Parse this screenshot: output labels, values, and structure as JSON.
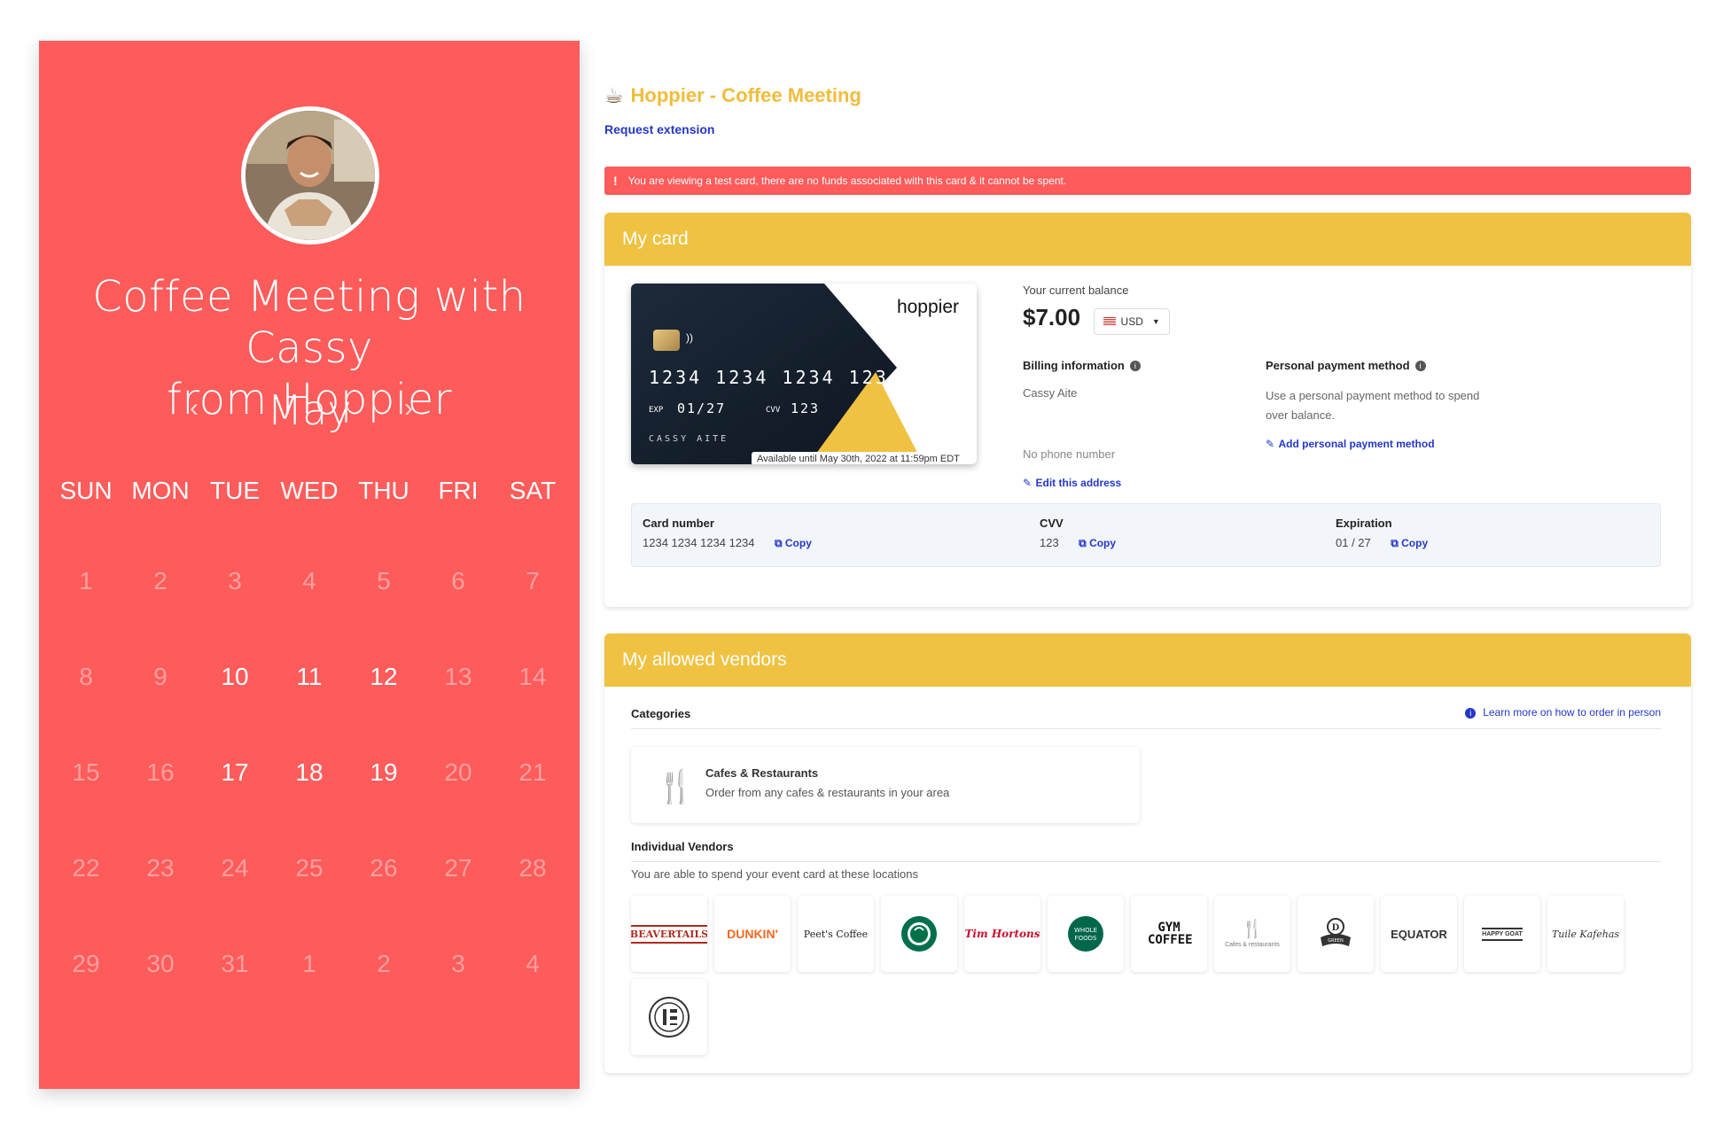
{
  "calendar": {
    "title": "Coffee Meeting with Cassy from Hoppier",
    "month": "May",
    "prev_icon": "chevron-left-icon",
    "next_icon": "chevron-right-icon",
    "weekdays": [
      "SUN",
      "MON",
      "TUE",
      "WED",
      "THU",
      "FRI",
      "SAT"
    ],
    "days": [
      {
        "n": "1",
        "active": false
      },
      {
        "n": "2",
        "active": false
      },
      {
        "n": "3",
        "active": false
      },
      {
        "n": "4",
        "active": false
      },
      {
        "n": "5",
        "active": false
      },
      {
        "n": "6",
        "active": false
      },
      {
        "n": "7",
        "active": false
      },
      {
        "n": "8",
        "active": false
      },
      {
        "n": "9",
        "active": false
      },
      {
        "n": "10",
        "active": true
      },
      {
        "n": "11",
        "active": true
      },
      {
        "n": "12",
        "active": true
      },
      {
        "n": "13",
        "active": false
      },
      {
        "n": "14",
        "active": false
      },
      {
        "n": "15",
        "active": false
      },
      {
        "n": "16",
        "active": false
      },
      {
        "n": "17",
        "active": true
      },
      {
        "n": "18",
        "active": true
      },
      {
        "n": "19",
        "active": true
      },
      {
        "n": "20",
        "active": false
      },
      {
        "n": "21",
        "active": false
      },
      {
        "n": "22",
        "active": false
      },
      {
        "n": "23",
        "active": false
      },
      {
        "n": "24",
        "active": false
      },
      {
        "n": "25",
        "active": false
      },
      {
        "n": "26",
        "active": false
      },
      {
        "n": "27",
        "active": false
      },
      {
        "n": "28",
        "active": false
      },
      {
        "n": "29",
        "active": false
      },
      {
        "n": "30",
        "active": false
      },
      {
        "n": "31",
        "active": false
      },
      {
        "n": "1",
        "active": false
      },
      {
        "n": "2",
        "active": false
      },
      {
        "n": "3",
        "active": false
      },
      {
        "n": "4",
        "active": false
      }
    ],
    "colors": {
      "panel": "#fe5b5b",
      "active_day": "#ffffff",
      "inactive_day": "#ff9f9f"
    }
  },
  "app": {
    "title": "Hoppier - Coffee Meeting",
    "title_icon": "coffee-cup-icon",
    "request_extension": "Request extension",
    "alert": "You are viewing a test card, there are no funds associated with this card & it cannot be spent.",
    "colors": {
      "accent": "#f0c242",
      "link": "#2438c7",
      "alert": "#fe5b5b"
    }
  },
  "my_card": {
    "header": "My card",
    "virtual_card": {
      "brand": "hoppier",
      "number": "1234 1234 1234 1234",
      "exp_label": "EXP",
      "exp": "01/27",
      "cvv_label": "CVV",
      "cvv": "123",
      "name": "CASSY AITE",
      "available": "Available until May 30th, 2022 at 11:59pm EDT"
    },
    "balance_label": "Your current balance",
    "balance": "$7.00",
    "currency": "USD",
    "billing_label": "Billing information",
    "billing_name": "Cassy Aite",
    "phone": "No phone number",
    "edit_address": "Edit this address",
    "personal_label": "Personal payment method",
    "personal_desc_1": "Use a personal payment method to spend",
    "personal_desc_2": "over balance.",
    "add_personal": "Add personal payment method",
    "fields": {
      "card_number_label": "Card number",
      "card_number": "1234 1234 1234 1234",
      "cvv_label": "CVV",
      "cvv": "123",
      "exp_label": "Expiration",
      "exp": "01 / 27",
      "copy": "Copy"
    }
  },
  "vendors": {
    "header": "My allowed vendors",
    "categories_label": "Categories",
    "learn_more": "Learn more on how to order in person",
    "category": {
      "title": "Cafes & Restaurants",
      "desc": "Order from any cafes & restaurants in your area"
    },
    "individual_label": "Individual Vendors",
    "individual_sub": "You are able to spend your event card at these locations",
    "logos": [
      {
        "name": "beaver-tails-logo",
        "text": "BEAVERTAILS",
        "color": "#b02a1e"
      },
      {
        "name": "dunkin-logo",
        "text": "DUNKIN'",
        "color": "#f26a21"
      },
      {
        "name": "peets-coffee-logo",
        "text": "Peet's Coffee",
        "color": "#222222"
      },
      {
        "name": "starbucks-logo",
        "text": "",
        "color": "#00704a"
      },
      {
        "name": "tim-hortons-logo",
        "text": "Tim Hortons",
        "color": "#c8102e"
      },
      {
        "name": "whole-foods-logo",
        "text": "WHOLE FOODS",
        "color": "#00674b"
      },
      {
        "name": "gym-coffee-logo",
        "text": "GYM COFFEE",
        "color": "#111111"
      },
      {
        "name": "cafes-restaurants-logo",
        "text": "Cafes & restaurants",
        "color": "#777777"
      },
      {
        "name": "green-coffee-logo",
        "text": "GREEN",
        "color": "#333333"
      },
      {
        "name": "equator-logo",
        "text": "EQUATOR",
        "color": "#333333"
      },
      {
        "name": "happy-goat-logo",
        "text": "HAPPY GOAT",
        "color": "#333333"
      },
      {
        "name": "tuile-logo",
        "text": "Tuile Kafehas",
        "color": "#333333"
      },
      {
        "name": "coffee-emblem-logo",
        "text": "",
        "color": "#333333"
      }
    ]
  }
}
